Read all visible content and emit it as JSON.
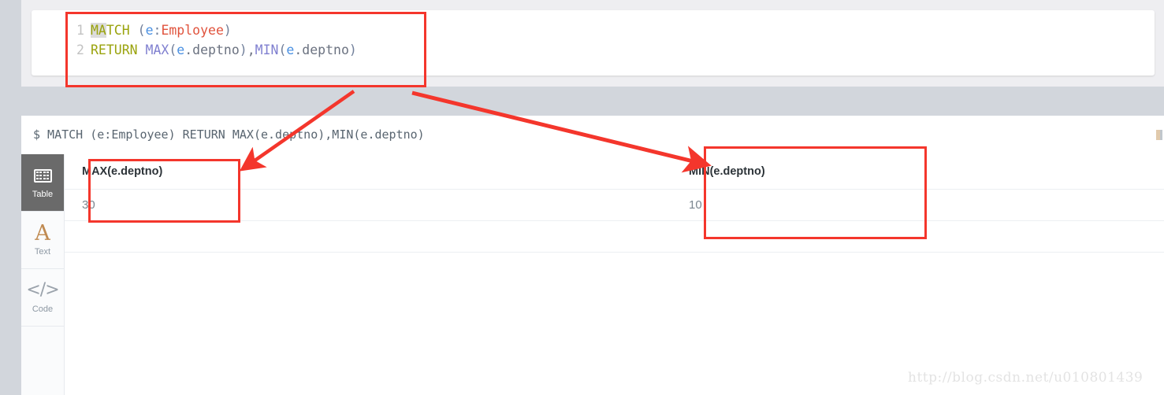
{
  "editor": {
    "lines": [
      {
        "number": "1",
        "tokens": [
          {
            "text": "MA",
            "kind": "keyword-hl"
          },
          {
            "text": "TCH",
            "kind": "keyword"
          },
          {
            "text": " ",
            "kind": "plain"
          },
          {
            "text": "(",
            "kind": "punct"
          },
          {
            "text": "e",
            "kind": "var"
          },
          {
            "text": ":",
            "kind": "punct"
          },
          {
            "text": "Employee",
            "kind": "label"
          },
          {
            "text": ")",
            "kind": "punct"
          }
        ]
      },
      {
        "number": "2",
        "tokens": [
          {
            "text": "RETURN",
            "kind": "keyword"
          },
          {
            "text": " ",
            "kind": "plain"
          },
          {
            "text": "MAX",
            "kind": "fn"
          },
          {
            "text": "(",
            "kind": "punct"
          },
          {
            "text": "e",
            "kind": "var"
          },
          {
            "text": ".deptno",
            "kind": "prop"
          },
          {
            "text": ")",
            "kind": "punct"
          },
          {
            "text": ",",
            "kind": "prop"
          },
          {
            "text": "MIN",
            "kind": "fn"
          },
          {
            "text": "(",
            "kind": "punct"
          },
          {
            "text": "e",
            "kind": "var"
          },
          {
            "text": ".deptno",
            "kind": "prop"
          },
          {
            "text": ")",
            "kind": "punct"
          }
        ]
      }
    ],
    "plain_text": "MATCH (e:Employee)\nRETURN MAX(e.deptno),MIN(e.deptno)"
  },
  "result": {
    "query_line": "$ MATCH (e:Employee) RETURN MAX(e.deptno),MIN(e.deptno)",
    "prompt_symbol": "$",
    "bar_icon_name": "pin-icon"
  },
  "sidebar": {
    "items": [
      {
        "label": "Table",
        "icon": "table-grid-icon",
        "active": true
      },
      {
        "label": "Text",
        "icon": "letter-a-icon",
        "active": false
      },
      {
        "label": "Code",
        "icon": "angle-brackets-icon",
        "active": false
      }
    ]
  },
  "table": {
    "columns": [
      "MAX(e.deptno)",
      "MIN(e.deptno)"
    ],
    "rows": [
      [
        "30",
        "10"
      ]
    ]
  },
  "annotations": {
    "accent_color": "#f4362c",
    "boxes": [
      {
        "name": "editor-query-highlight"
      },
      {
        "name": "max-column-highlight"
      },
      {
        "name": "min-column-highlight"
      }
    ],
    "arrows": [
      {
        "name": "arrow-to-max-column"
      },
      {
        "name": "arrow-to-min-column"
      }
    ]
  },
  "watermark": {
    "text": "http://blog.csdn.net/u010801439"
  }
}
